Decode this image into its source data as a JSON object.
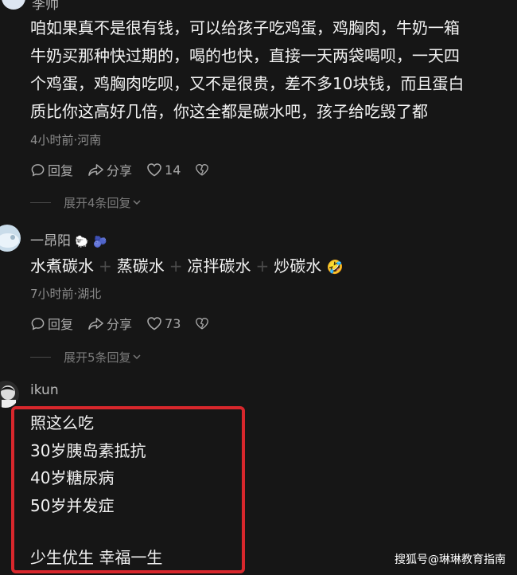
{
  "comments": [
    {
      "username": "李帅",
      "body_lines": [
        "咱如果真不是很有钱，可以给孩子吃鸡蛋，鸡胸肉，牛奶一箱",
        "牛奶买那种快过期的，喝的也快，直接一天两袋喝呗，一天四",
        "个鸡蛋，鸡胸肉吃呗，又不是很贵，差不多10块钱，而且蛋白",
        "质比你这高好几倍，你这全都是碳水吧，孩子给吃毁了都"
      ],
      "meta": "4小时前·河南",
      "reply_label": "回复",
      "share_label": "分享",
      "like_count": "14",
      "expand_label": "展开4条回复"
    },
    {
      "username": "一昂阳",
      "name_emojis": [
        "🐑",
        "🫐"
      ],
      "body_parts": [
        "水煮碳水",
        "蒸碳水",
        "凉拌碳水",
        "炒碳水"
      ],
      "body_separator": "+",
      "body_emoji": "🤣",
      "meta": "7小时前·湖北",
      "reply_label": "回复",
      "share_label": "分享",
      "like_count": "73",
      "expand_label": "展开5条回复"
    },
    {
      "username": "ikun",
      "body_lines": [
        "照这么吃",
        "30岁胰岛素抵抗",
        "40岁糖尿病",
        "50岁并发症",
        "",
        "少生优生 幸福一生"
      ]
    }
  ],
  "watermark": "搜狐号@琳琳教育指南",
  "colors": {
    "highlight_box": "#d8272c",
    "background": "#161616"
  },
  "icons": [
    "reply-icon",
    "share-icon",
    "heart-icon",
    "dislike-icon",
    "chevron-down-icon"
  ]
}
